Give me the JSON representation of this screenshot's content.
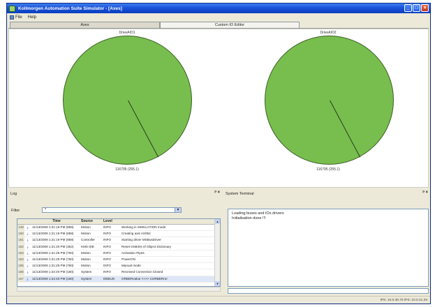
{
  "window": {
    "title": "Kollmorgen Automation Suite Simulator - [Axes]"
  },
  "menu": [
    {
      "label": "File"
    },
    {
      "label": "Help"
    }
  ],
  "tabs": [
    {
      "label": "Axes"
    },
    {
      "label": "Custom IO Editor"
    }
  ],
  "drives": [
    {
      "name": "DriveAIO1",
      "value": "116795 (255.1)"
    },
    {
      "name": "DriveAIO2",
      "value": "116795 (255.1)"
    }
  ],
  "log": {
    "title": "Log",
    "filter_label": "Filter",
    "filter_value": "*",
    "columns": [
      "",
      "Time",
      "Source",
      "Level",
      ""
    ],
    "rows": [
      {
        "num": "149",
        "time": "11/13/2009 1:21:19 PM (858)",
        "source": "Motion",
        "level": "INFO",
        "message": "Working in SIMULATION mode"
      },
      {
        "num": "150",
        "time": "11/13/2009 1:21:19 PM (858)",
        "source": "Motion",
        "level": "INFO",
        "message": "Creating axis AX052"
      },
      {
        "num": "151",
        "time": "11/13/2009 1:21:19 PM (858)",
        "source": "Controller",
        "level": "INFO",
        "message": "Starting driver MSBusDriver"
      },
      {
        "num": "152",
        "time": "11/13/2009 1:21:20 PM (352)",
        "source": "KMS IDE",
        "level": "INFO",
        "message": "Reset OnBIOs of Object Dictionary"
      },
      {
        "num": "153",
        "time": "11/13/2009 1:21:25 PM (760)",
        "source": "Motion",
        "level": "INFO",
        "message": "Activation Pipes"
      },
      {
        "num": "154",
        "time": "11/13/2009 1:21:25 PM (760)",
        "source": "Motion",
        "level": "INFO",
        "message": "PowerON"
      },
      {
        "num": "155",
        "time": "11/13/2009 1:21:25 PM (760)",
        "source": "Motion",
        "level": "INFO",
        "message": "Manual mode"
      },
      {
        "num": "156",
        "time": "11/13/2009 1:24:40 PM (160)",
        "source": "System",
        "level": "INFO",
        "message": "Received Connection Closed"
      },
      {
        "num": "157",
        "time": "11/13/2009 1:24:40 PM (160)",
        "source": "System",
        "level": "DEBUG",
        "message": "ORBERvalue >>>> CORBERror"
      }
    ]
  },
  "terminal": {
    "title": "System Terminal",
    "lines": [
      "Loading buses and IOs drivers",
      "Initialisation done !!!"
    ]
  },
  "status": {
    "text": "IPS: 10.0.36.70  IPS: 10.0.41.29"
  }
}
